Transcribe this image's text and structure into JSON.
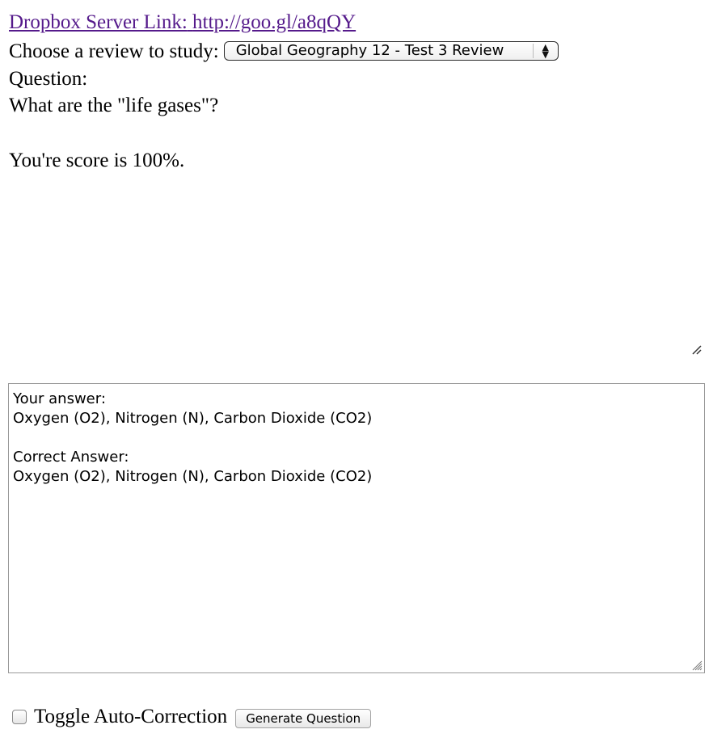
{
  "header": {
    "link_label": "Dropbox Server Link:",
    "link_url_text": "http://goo.gl/a8qQY"
  },
  "review_picker": {
    "label": "Choose a review to study:",
    "selected": "Global Geography 12 - Test 3 Review"
  },
  "question": {
    "heading": "Question:",
    "text": "What are the \"life gases\"?"
  },
  "score": {
    "text": "You're score is 100%."
  },
  "output": {
    "your_answer_label": "Your answer:",
    "your_answer": "Oxygen (O2), Nitrogen (N), Carbon Dioxide (CO2)",
    "correct_answer_label": "Correct Answer:",
    "correct_answer": "Oxygen (O2), Nitrogen (N), Carbon Dioxide (CO2)"
  },
  "controls": {
    "toggle_label": "Toggle Auto-Correction",
    "toggle_checked": false,
    "generate_label": "Generate Question"
  }
}
